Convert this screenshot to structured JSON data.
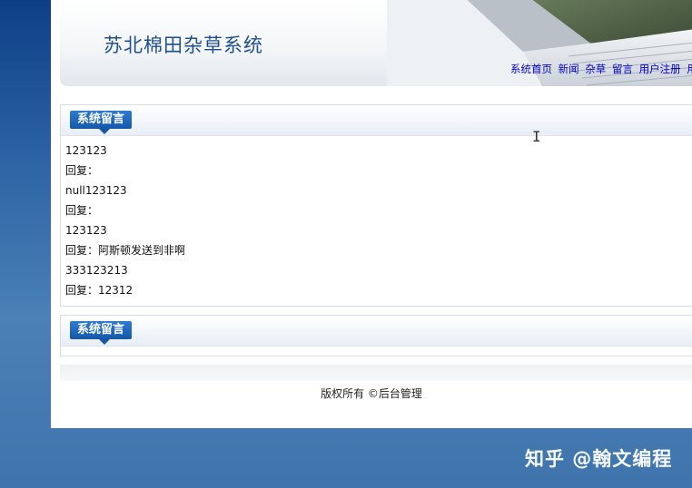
{
  "header": {
    "site_title": "苏北棉田杂草系统",
    "nav": [
      "系统首页",
      "新闻",
      "杂草",
      "留言",
      "用户注册",
      "用"
    ]
  },
  "panels": [
    {
      "title": "系统留言",
      "messages": [
        "123123",
        "回复：",
        "null123123",
        "回复：",
        "123123",
        "回复：阿斯顿发送到非啊",
        "333123213",
        "回复：12312"
      ]
    },
    {
      "title": "系统留言"
    }
  ],
  "footer": {
    "copyright": "版权所有 ©后台管理"
  },
  "watermark": "知乎 @翰文编程",
  "colors": {
    "background_blue": "#2e66a6",
    "nav_link": "#0000cc",
    "title_text": "#1f4f8f",
    "tag_blue": "#1558a8"
  }
}
